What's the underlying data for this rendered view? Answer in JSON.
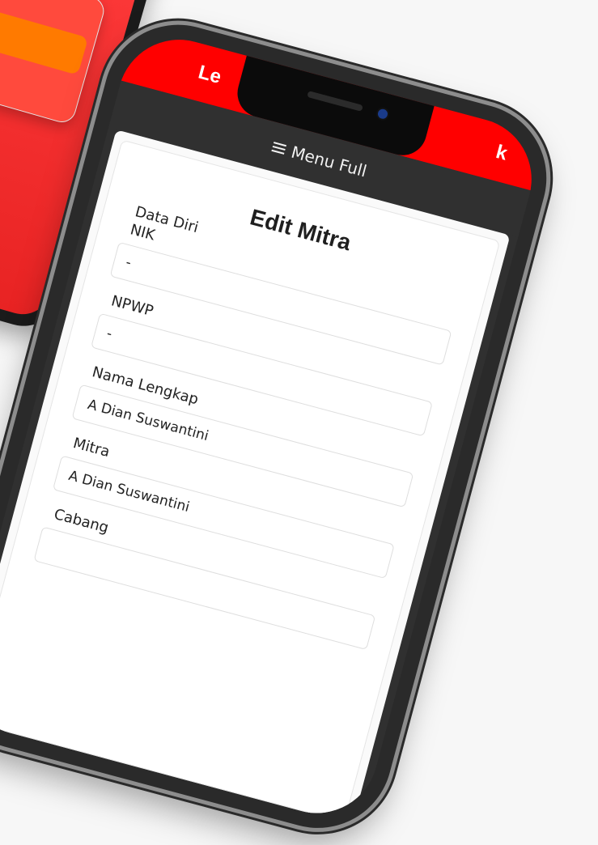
{
  "header": {
    "brand_left": "Le",
    "brand_right": "k"
  },
  "menu": {
    "toggle_label": "Menu Full"
  },
  "page": {
    "title": "Edit Mitra",
    "section_title": "Data Diri"
  },
  "fields": {
    "nik": {
      "label": "NIK",
      "value": "-"
    },
    "npwp": {
      "label": "NPWP",
      "value": "-"
    },
    "nama_lengkap": {
      "label": "Nama Lengkap",
      "value": "A Dian Suswantini"
    },
    "mitra": {
      "label": "Mitra",
      "value": "A Dian Suswantini"
    },
    "cabang": {
      "label": "Cabang",
      "value": ""
    }
  },
  "colors": {
    "accent_red": "#ff0000",
    "menu_bg": "#303030",
    "orange": "#ff7a00"
  },
  "icons": {
    "menu": "hamburger-icon"
  }
}
